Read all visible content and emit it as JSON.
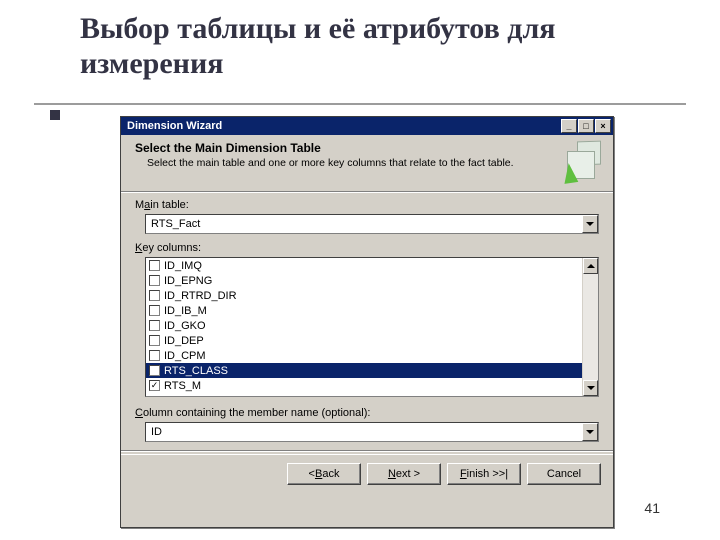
{
  "slide": {
    "title": "Выбор таблицы и её атрибутов для измерения",
    "page_number": "41"
  },
  "dialog": {
    "title": "Dimension Wizard",
    "window_controls": {
      "min": "_",
      "max": "□",
      "close": "×"
    },
    "header": {
      "heading": "Select the Main Dimension Table",
      "subtext": "Select the main table and one or more key columns that relate to the fact table."
    },
    "main_table": {
      "label_pre": "M",
      "label_u": "a",
      "label_post": "in table:",
      "value": "RTS_Fact"
    },
    "key_columns": {
      "label_u": "K",
      "label_post": "ey columns:",
      "items": [
        {
          "label": "ID_IMQ",
          "checked": false,
          "selected": false
        },
        {
          "label": "ID_EPNG",
          "checked": false,
          "selected": false
        },
        {
          "label": "ID_RTRD_DIR",
          "checked": false,
          "selected": false
        },
        {
          "label": "ID_IB_M",
          "checked": false,
          "selected": false
        },
        {
          "label": "ID_GKO",
          "checked": false,
          "selected": false
        },
        {
          "label": "ID_DEP",
          "checked": false,
          "selected": false
        },
        {
          "label": "ID_CPM",
          "checked": false,
          "selected": false
        },
        {
          "label": "RTS_CLASS",
          "checked": false,
          "selected": true
        },
        {
          "label": "RTS_M",
          "checked": true,
          "selected": false
        }
      ]
    },
    "member_name": {
      "label_u": "C",
      "label_post": "olumn containing the member name (optional):",
      "value": "ID"
    },
    "buttons": {
      "back_pre": "< ",
      "back_u": "B",
      "back_post": "ack",
      "next_u": "N",
      "next_post": "ext >",
      "finish_u": "F",
      "finish_post": "inish >>|",
      "cancel": "Cancel"
    }
  }
}
